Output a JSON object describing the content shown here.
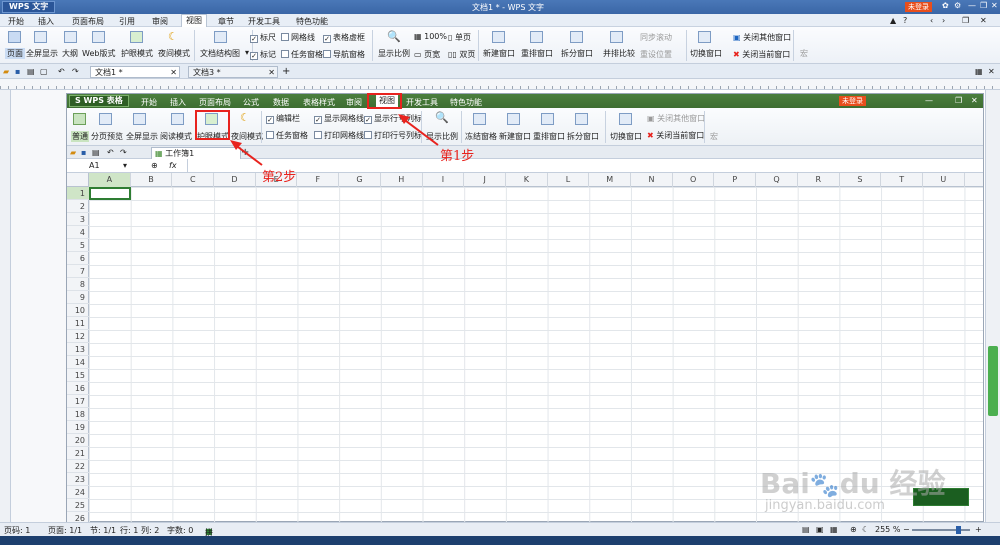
{
  "app": {
    "logo": "WPS 文字",
    "title": "文档1 * - WPS 文字",
    "login": "未登录"
  },
  "menu": [
    "开始",
    "插入",
    "页面布局",
    "引用",
    "审阅",
    "视图",
    "章节",
    "开发工具",
    "特色功能"
  ],
  "ribbon": {
    "views": [
      "页面",
      "全屏显示",
      "大纲",
      "Web版式",
      "护眼模式",
      "夜间模式"
    ],
    "doc_map": "文档结构图",
    "checks": [
      {
        "label": "标尺",
        "checked": true
      },
      {
        "label": "网格线",
        "checked": false
      },
      {
        "label": "表格虚框",
        "checked": true
      },
      {
        "label": "标记",
        "checked": true
      },
      {
        "label": "任务窗格",
        "checked": false
      },
      {
        "label": "导航窗格",
        "checked": false
      }
    ],
    "zoom": "显示比例",
    "zoom100": "100%",
    "single": "单页",
    "width": "页宽",
    "double": "双页",
    "windows": [
      "新建窗口",
      "重排窗口",
      "拆分窗口",
      "并排比较",
      "切换窗口"
    ],
    "sync": "同步滚动",
    "reset": "重设位置",
    "close_other": "关闭其他窗口",
    "close_current": "关闭当前窗口",
    "macro": "宏"
  },
  "tabs": [
    "文档1 *",
    "文档3 *"
  ],
  "inner": {
    "logo": "S WPS 表格",
    "menu": [
      "开始",
      "插入",
      "页面布局",
      "公式",
      "数据",
      "表格样式",
      "审阅",
      "视图",
      "开发工具",
      "特色功能"
    ],
    "login": "未登录",
    "views": [
      "普通",
      "分页预览",
      "全屏显示",
      "阅读模式",
      "护眼模式",
      "夜间模式"
    ],
    "checks": [
      {
        "label": "编辑栏",
        "checked": true
      },
      {
        "label": "显示网格线",
        "checked": true
      },
      {
        "label": "显示行号列标",
        "checked": true
      },
      {
        "label": "任务窗格",
        "checked": false
      },
      {
        "label": "打印网格线",
        "checked": false
      },
      {
        "label": "打印行号列标",
        "checked": false
      }
    ],
    "zoom": "显示比例",
    "windows": [
      "冻结窗格",
      "新建窗口",
      "重排窗口",
      "拆分窗口",
      "切换窗口"
    ],
    "close_other": "关闭其他窗口",
    "close_current": "关闭当前窗口",
    "macro": "宏",
    "sheet": "工作簿1",
    "cell": "A1",
    "fx": "fx",
    "columns": [
      "A",
      "B",
      "C",
      "D",
      "E",
      "F",
      "G",
      "H",
      "I",
      "J",
      "K",
      "L",
      "M",
      "N",
      "O",
      "P",
      "Q",
      "R",
      "S",
      "T",
      "U"
    ],
    "rows": [
      "1",
      "2",
      "3",
      "4",
      "5",
      "6",
      "7",
      "8",
      "9",
      "10",
      "11",
      "12",
      "13",
      "14",
      "15",
      "16",
      "17",
      "18",
      "19",
      "20",
      "21",
      "22",
      "23",
      "24",
      "25",
      "26"
    ]
  },
  "annotations": {
    "step1": "第1步",
    "step2": "第2步"
  },
  "status": {
    "page": "页码: 1",
    "pages": "页面: 1/1",
    "section": "节: 1/1",
    "line": "行: 1",
    "col": "列: 2",
    "words": "字数: 0",
    "spell": "拼写检查",
    "zoom": "255 %"
  },
  "watermark": "jingyan.baidu.com"
}
